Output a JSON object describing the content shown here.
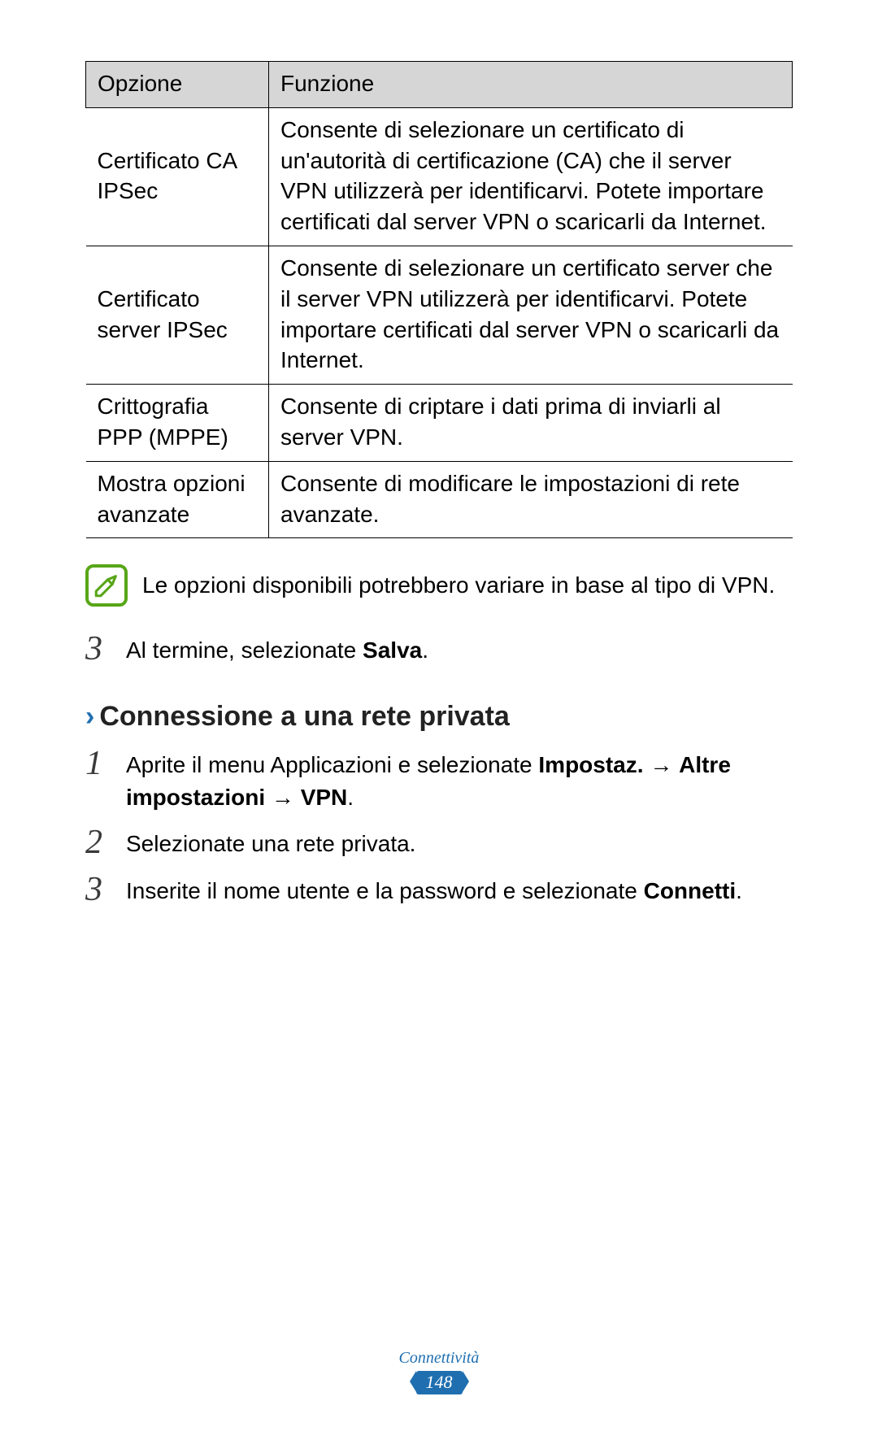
{
  "table": {
    "header": {
      "option": "Opzione",
      "function": "Funzione"
    },
    "rows": [
      {
        "option": "Certificato CA IPSec",
        "function": "Consente di selezionare un certificato di un'autorità di certificazione (CA) che il server VPN utilizzerà per identificarvi. Potete importare certificati dal server VPN o scaricarli da Internet."
      },
      {
        "option": "Certificato server IPSec",
        "function": "Consente di selezionare un certificato server che il server VPN utilizzerà per identificarvi. Potete importare certificati dal server VPN o scaricarli da Internet."
      },
      {
        "option": "Crittografia PPP (MPPE)",
        "function": "Consente di criptare i dati prima di inviarli al server VPN."
      },
      {
        "option": "Mostra opzioni avanzate",
        "function": "Consente di modificare le impostazioni di rete avanzate."
      }
    ]
  },
  "note": "Le opzioni disponibili potrebbero variare in base al tipo di VPN.",
  "step_prev_3": {
    "pre": "Al termine, selezionate ",
    "bold": "Salva",
    "post": "."
  },
  "section_heading": "Connessione a una rete privata",
  "section_steps": {
    "s1": {
      "pre": "Aprite il menu Applicazioni e selezionate ",
      "b1": "Impostaz.",
      "mid1": " → ",
      "b2": "Altre impostazioni",
      "mid2": " → ",
      "b3": "VPN",
      "post": "."
    },
    "s2": "Selezionate una rete privata.",
    "s3": {
      "pre": "Inserite il nome utente e la password e selezionate ",
      "bold": "Connetti",
      "post": "."
    }
  },
  "nums": {
    "n1": "1",
    "n2": "2",
    "n3": "3"
  },
  "footer": {
    "chapter": "Connettività",
    "page": "148"
  }
}
